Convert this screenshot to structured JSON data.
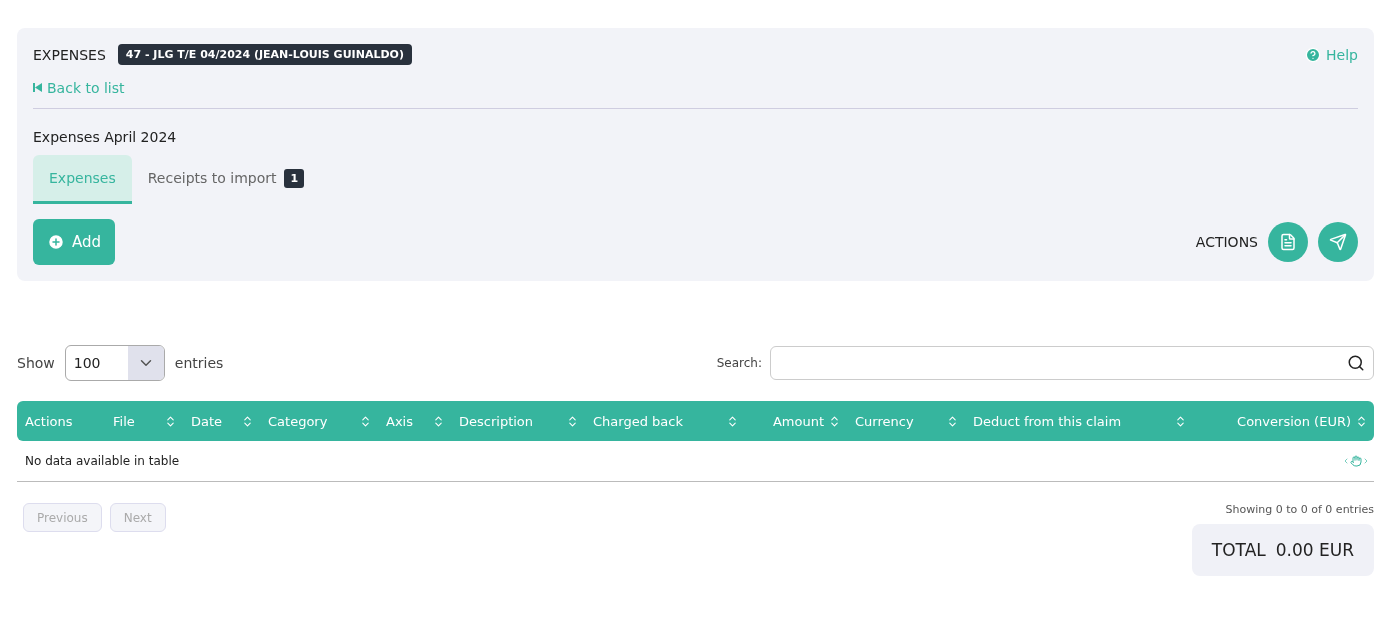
{
  "header": {
    "title": "EXPENSES",
    "badge": "47 - JLG T/E 04/2024 (JEAN-LOUIS GUINALDO)",
    "help": "Help",
    "back_link": "Back to list"
  },
  "subtitle": "Expenses April 2024",
  "tabs": [
    {
      "label": "Expenses",
      "selected": true
    },
    {
      "label": "Receipts to import",
      "selected": false,
      "count": "1"
    }
  ],
  "add_button": "Add",
  "actions_label": "ACTIONS",
  "show": {
    "before": "Show",
    "value": "100",
    "after": "entries"
  },
  "search": {
    "label": "Search:"
  },
  "table": {
    "columns": [
      {
        "label": "Actions",
        "sortable": false,
        "kind": "text"
      },
      {
        "label": "File",
        "sortable": true,
        "kind": "text"
      },
      {
        "label": "Date",
        "sortable": true,
        "kind": "text"
      },
      {
        "label": "Category",
        "sortable": true,
        "kind": "text"
      },
      {
        "label": "Axis",
        "sortable": true,
        "kind": "text"
      },
      {
        "label": "Description",
        "sortable": true,
        "kind": "text"
      },
      {
        "label": "Charged back",
        "sortable": true,
        "kind": "text"
      },
      {
        "label": "Amount",
        "sortable": true,
        "kind": "numeric"
      },
      {
        "label": "Currency",
        "sortable": true,
        "kind": "text"
      },
      {
        "label": "Deduct from this claim",
        "sortable": true,
        "kind": "text"
      },
      {
        "label": "Conversion (EUR)",
        "sortable": true,
        "kind": "numeric"
      }
    ],
    "empty": "No data available in table"
  },
  "pagination": {
    "previous": "Previous",
    "next": "Next",
    "info": "Showing 0 to 0 of 0 entries"
  },
  "total": {
    "label": "TOTAL",
    "value": "0.00 EUR"
  }
}
